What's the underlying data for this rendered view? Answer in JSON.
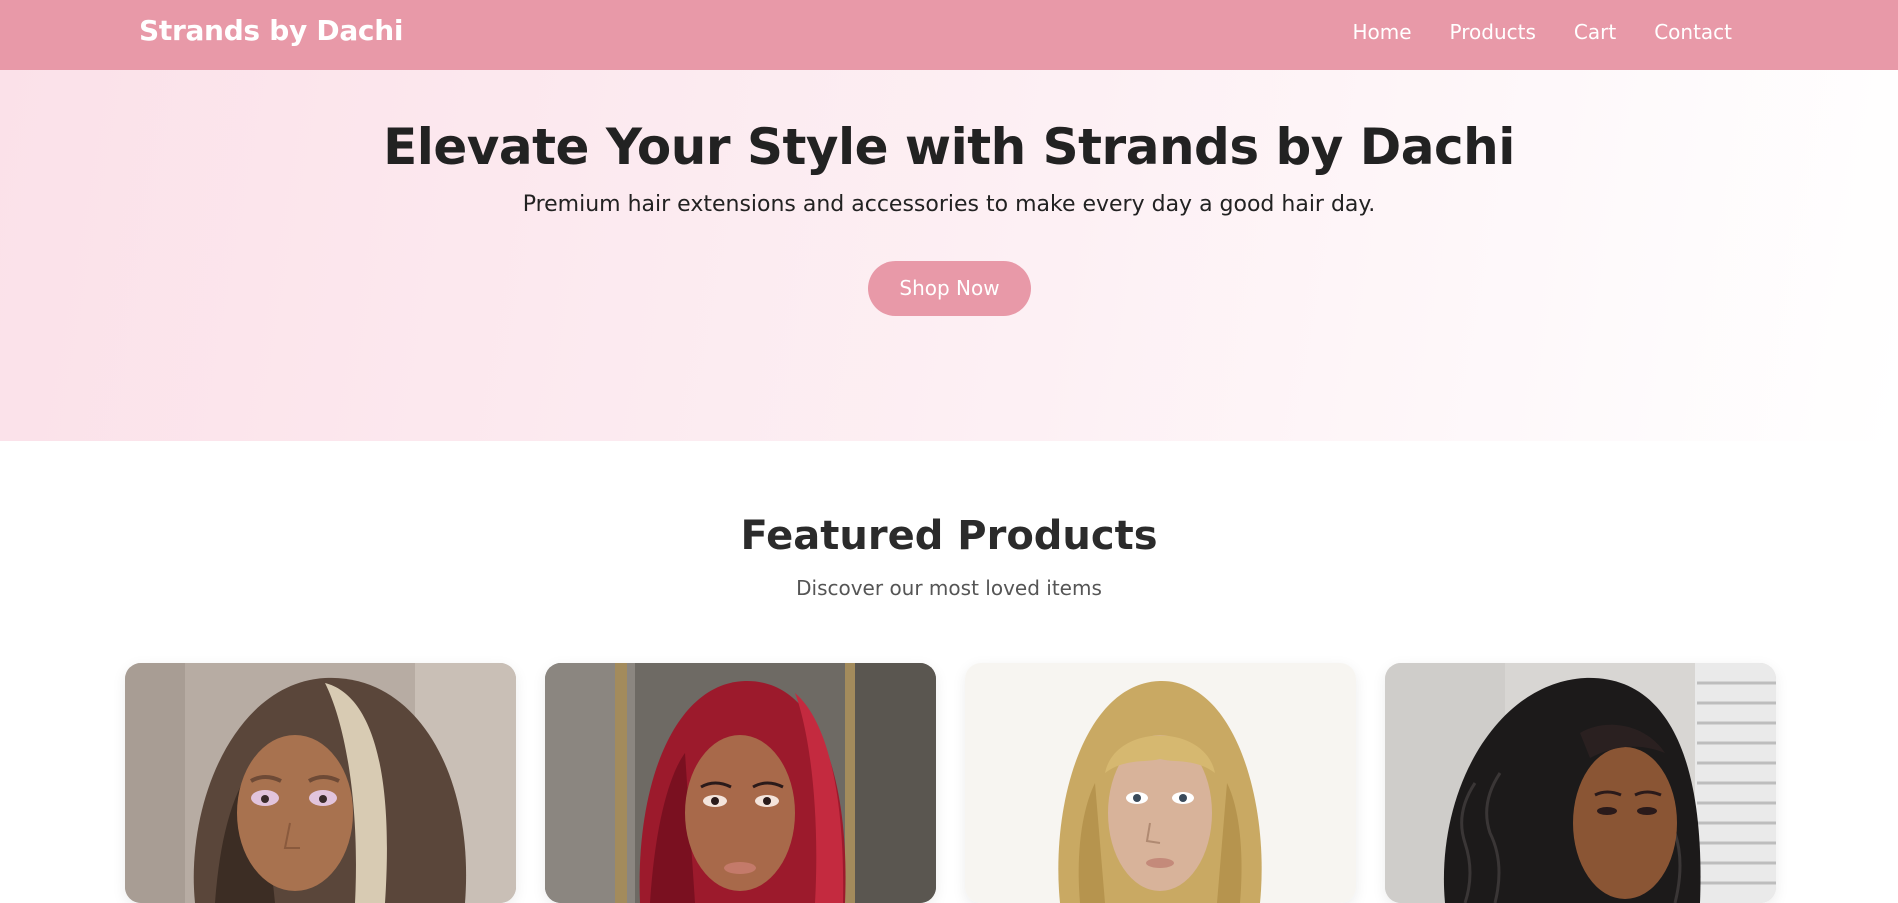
{
  "navbar": {
    "brand": "Strands by Dachi",
    "links": [
      "Home",
      "Products",
      "Cart",
      "Contact"
    ]
  },
  "hero": {
    "title": "Elevate Your Style with Strands by Dachi",
    "subtitle": "Premium hair extensions and accessories to make every day a good hair day.",
    "cta_label": "Shop Now"
  },
  "featured": {
    "title": "Featured Products",
    "subtitle": "Discover our most loved items",
    "products": [
      {
        "icon": "blonde-highlight-wig-image"
      },
      {
        "icon": "burgundy-straight-wig-image"
      },
      {
        "icon": "blonde-bangs-wig-image"
      },
      {
        "icon": "black-curly-wig-image"
      }
    ]
  },
  "colors": {
    "brand_pink": "#e899a8",
    "hero_gradient_start": "#fbe1e9",
    "text_dark": "#222222"
  }
}
